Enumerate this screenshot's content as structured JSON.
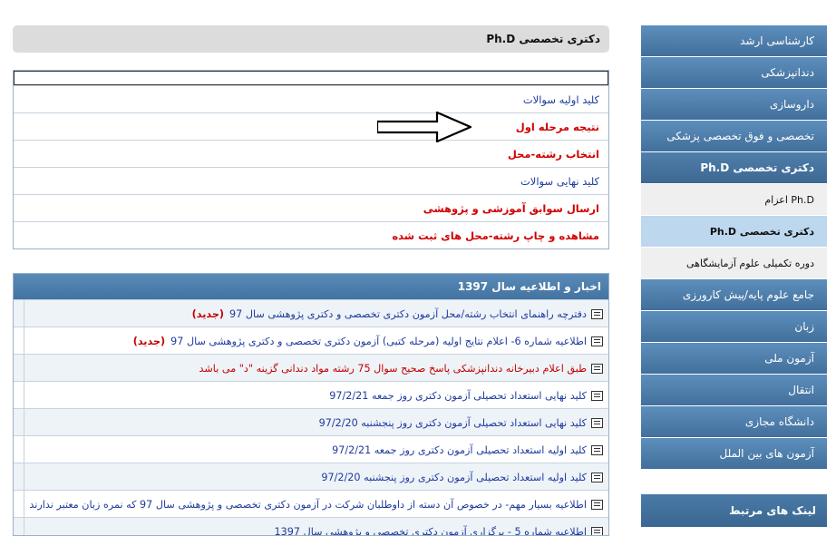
{
  "sidebar": {
    "items": [
      {
        "label": "کارشناسی ارشد",
        "kind": "main"
      },
      {
        "label": "دندانپزشکی",
        "kind": "main"
      },
      {
        "label": "داروسازی",
        "kind": "main"
      },
      {
        "label": "تخصصی و فوق تخصصی پزشکی",
        "kind": "main"
      },
      {
        "label": "دکتری تخصصی Ph.D",
        "kind": "active"
      },
      {
        "label": "Ph.D اعزام",
        "kind": "sub"
      },
      {
        "label": "دکتری تخصصی Ph.D",
        "kind": "sub-active"
      },
      {
        "label": "دوره تکمیلی علوم آزمایشگاهی",
        "kind": "sub"
      },
      {
        "label": "جامع علوم پایه/پیش کارورزی",
        "kind": "main"
      },
      {
        "label": "زبان",
        "kind": "main"
      },
      {
        "label": "آزمون ملی",
        "kind": "main"
      },
      {
        "label": "انتقال",
        "kind": "main"
      },
      {
        "label": "دانشگاه مجازی",
        "kind": "main"
      },
      {
        "label": "آزمون های بین الملل",
        "kind": "main"
      }
    ],
    "related_links_title": "لینک های مرتبط"
  },
  "page": {
    "title": "دکتری تخصصی Ph.D"
  },
  "links": [
    {
      "label": "کلید اولیه سوالات",
      "style": "blue"
    },
    {
      "label": "نتیجه مرحله اول",
      "style": "red"
    },
    {
      "label": "انتخاب رشته-محل",
      "style": "red"
    },
    {
      "label": "کلید نهایی سوالات",
      "style": "blue"
    },
    {
      "label": "ارسال سوابق آموزشی و پژوهشی",
      "style": "red"
    },
    {
      "label": "مشاهده و چاپ رشته-محل های ثبت شده",
      "style": "red"
    }
  ],
  "news": {
    "title": "اخبار و اطلاعیه سال 1397",
    "items": [
      {
        "text": "دفترچه راهنمای انتخاب رشته/محل آزمون دکتری تخصصی و دکتری پژوهشی سال 97",
        "badge": "(جدید)",
        "style": "blue"
      },
      {
        "text": "اطلاعیه شماره 6- اعلام نتایج اولیه (مرحله کتبی) آزمون دکتری تخصصی و دکتری پژوهشی سال 97",
        "badge": "(جدید)",
        "style": "blue"
      },
      {
        "text": "طبق اعلام دبیرخانه دندانپزشکی پاسخ صحیح سوال 75 رشته مواد دندانی گزینه \"د\" می باشد",
        "badge": "",
        "style": "red"
      },
      {
        "text": "کلید نهایی استعداد تحصیلی آزمون دکتری روز جمعه 97/2/21",
        "badge": "",
        "style": "blue"
      },
      {
        "text": "کلید نهایی استعداد تحصیلی آزمون دکتری روز پنجشنبه 97/2/20",
        "badge": "",
        "style": "blue"
      },
      {
        "text": "کلید اولیه استعداد تحصیلی آزمون دکتری روز جمعه 97/2/21",
        "badge": "",
        "style": "blue"
      },
      {
        "text": "کلید اولیه استعداد تحصیلی آزمون دکتری روز پنجشنبه 97/2/20",
        "badge": "",
        "style": "blue"
      },
      {
        "text": "اطلاعیه بسیار مهم- در خصوص آن دسته از داوطلبان شرکت در آزمون دکتری تخصصی و پژوهشی سال 97 که نمره زبان معتبر ندارند",
        "badge": "",
        "style": "blue"
      },
      {
        "text": "اطلاعیه شماره 5 - برگزاری آزمون دکتری تخصصی و پژوهشی سال 1397",
        "badge": "",
        "style": "blue"
      }
    ]
  }
}
